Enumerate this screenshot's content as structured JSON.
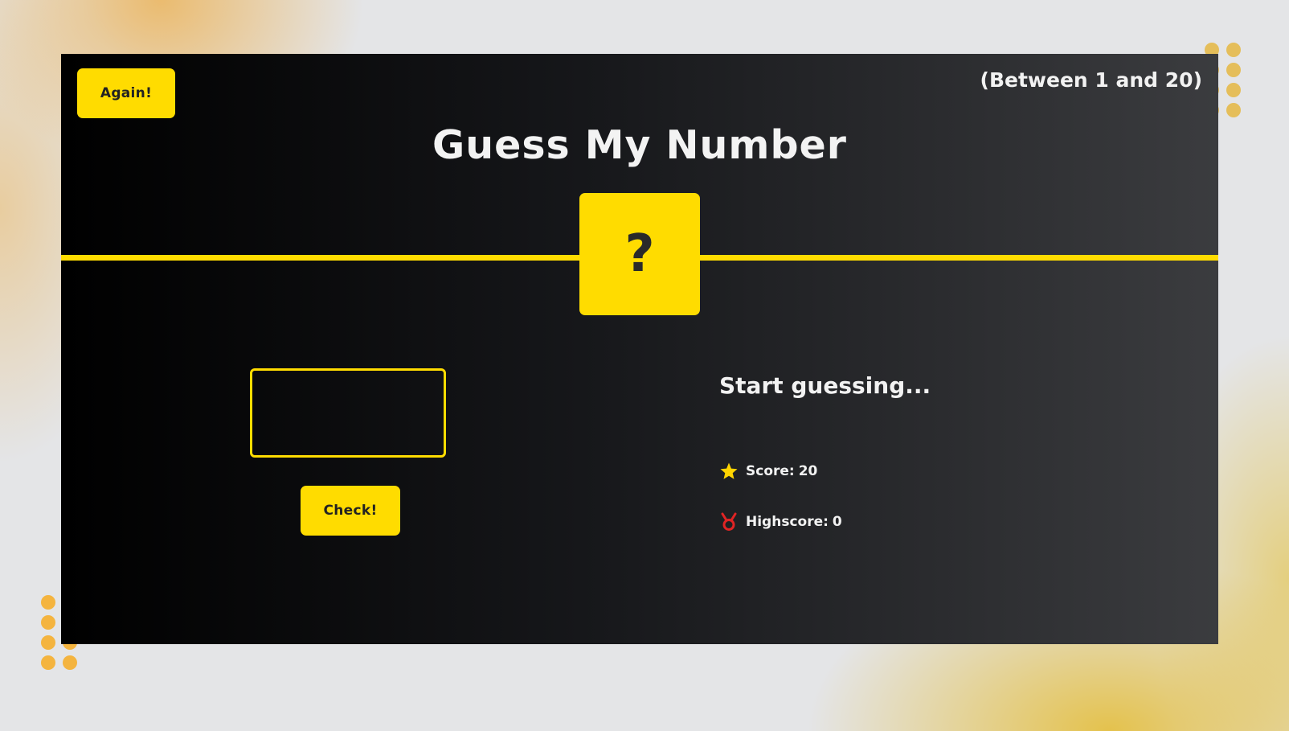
{
  "header": {
    "again_label": "Again!",
    "range_label": "(Between 1 and 20)",
    "title": "Guess My Number"
  },
  "secret_box": {
    "value": "?"
  },
  "guess": {
    "value": "",
    "check_label": "Check!"
  },
  "status": {
    "message": "Start guessing...",
    "score_label": "Score:",
    "score_value": "20",
    "highscore_label": "Highscore:",
    "highscore_value": "0",
    "score_icon": "star-icon",
    "highscore_icon": "medal-icon"
  },
  "colors": {
    "accent": "#ffdc00",
    "panel_dark": "#000000",
    "panel_light": "#3b3c3f",
    "text": "#f2f2f2",
    "medal": "#e02424",
    "star": "#ffd400"
  }
}
